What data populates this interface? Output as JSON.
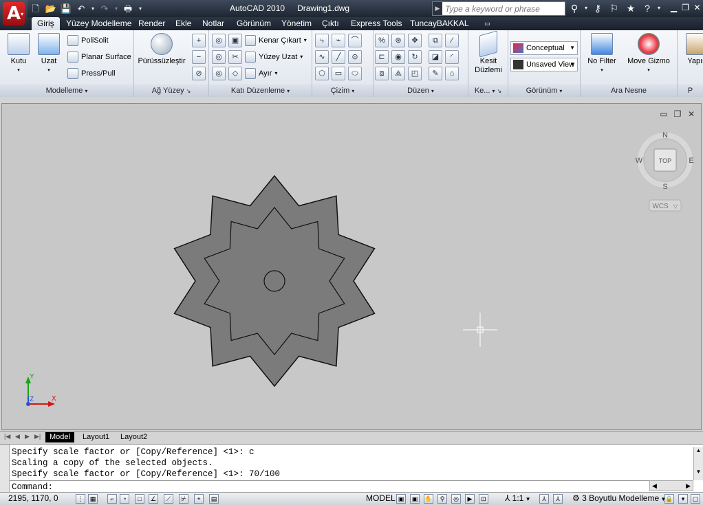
{
  "app": {
    "name": "AutoCAD 2010",
    "document": "Drawing1.dwg",
    "app_letter": "A"
  },
  "search": {
    "placeholder": "Type a keyword or phrase"
  },
  "tabs": [
    "Giriş",
    "Yüzey Modelleme",
    "Render",
    "Ekle",
    "Notlar",
    "Görünüm",
    "Yönetim",
    "Çıktı",
    "Express Tools",
    "TuncayBAKKAL"
  ],
  "active_tab": "Giriş",
  "ribbon": {
    "modelleme": {
      "title": "Modelleme",
      "kutu": "Kutu",
      "uzat": "Uzat",
      "polisolit": "PoliSolit",
      "planar": "Planar Surface",
      "presspull": "Press/Pull"
    },
    "ag_yuzey": {
      "title": "Ağ Yüzey",
      "puruzsuz": "Pürüssüzleştir"
    },
    "kati": {
      "title": "Katı Düzenleme",
      "kenar": "Kenar Çıkart",
      "yuzey_uzat": "Yüzey Uzat",
      "ayir": "Ayır"
    },
    "cizim": {
      "title": "Çizim"
    },
    "duzen": {
      "title": "Düzen"
    },
    "kesit": {
      "title": "Ke...",
      "label1": "Kesit",
      "label2": "Düzlemi"
    },
    "gorunum": {
      "title": "Görünüm",
      "visual_style": "Conceptual",
      "view": "Unsaved View"
    },
    "ara_nesne": {
      "title": "Ara Nesne",
      "filter": "No Filter",
      "gizmo": "Move Gizmo"
    },
    "yapis": {
      "label": "Yapış",
      "title": "P"
    }
  },
  "viewcube": {
    "n": "N",
    "s": "S",
    "e": "E",
    "w": "W",
    "face": "TOP",
    "wcs": "WCS"
  },
  "ucs": {
    "x": "X",
    "y": "Y",
    "z": "Z"
  },
  "layout_tabs": [
    "Model",
    "Layout1",
    "Layout2"
  ],
  "command_history": [
    "Specify scale factor or [Copy/Reference] <1>: c",
    "Scaling a copy of the selected objects.",
    "Specify scale factor or [Copy/Reference] <1>: 70/100"
  ],
  "command_prompt": "Command:",
  "status": {
    "coords": "2195, 1170, 0",
    "model": "MODEL",
    "scale": "1:1",
    "workspace": "3 Boyutlu Modelleme"
  }
}
